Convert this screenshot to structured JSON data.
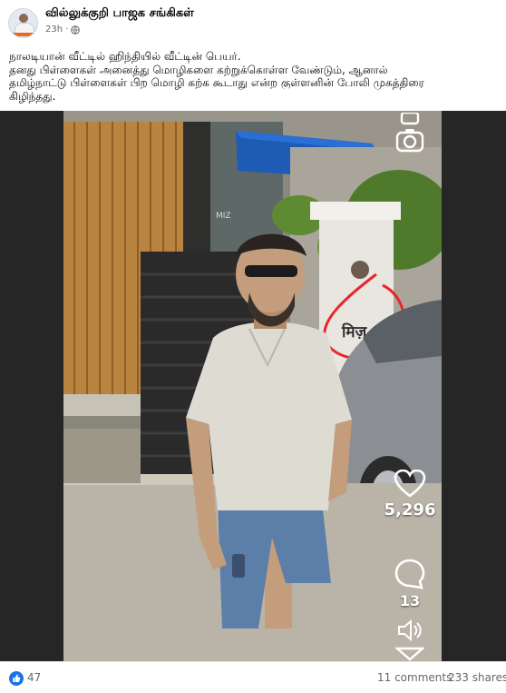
{
  "header": {
    "page_name": "வில்லுக்குறி பாஜக சங்கிகள்",
    "timestamp": "23h",
    "separator": "·",
    "privacy_icon": "globe-icon"
  },
  "post": {
    "lines": [
      "நாலடியான் வீட்டில் ஹிந்தியில் வீட்டின் பெயர்.",
      "தனது பிள்ளைகள் அனைத்து மொழிகளை கற்றுக்கொள்ள வேண்டும், ஆனால்",
      "தமிழ்நாட்டு பிள்ளைகள் பிற மொழி கற்க கூடாது என்ற குள்ளனின் போலி முகத்திரை",
      "கிழிந்தது."
    ]
  },
  "video": {
    "house_sign": "मिज़",
    "wall_letters": "MIZ",
    "highlight_color": "#e8262b",
    "likes": "5,296",
    "comments": "13",
    "icons": [
      "camera-icon",
      "heart-icon",
      "comment-icon",
      "volume-icon",
      "share-icon"
    ]
  },
  "footer": {
    "reaction_icon": "like-icon",
    "reactions": "47",
    "comments": "11 comments",
    "shares": "233 shares"
  }
}
